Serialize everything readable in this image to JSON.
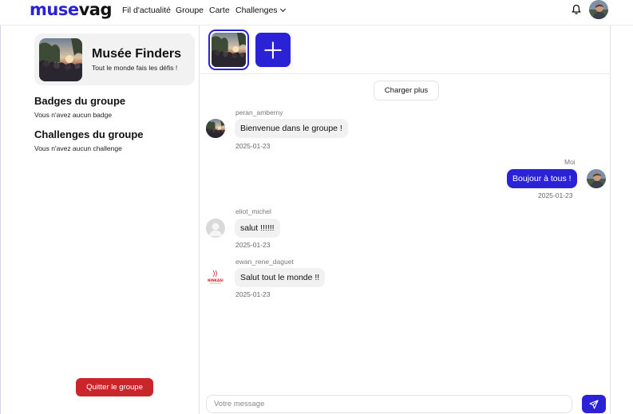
{
  "brand": {
    "part1": "muse",
    "part2": "vag",
    "accent": "#2b22d6"
  },
  "nav": {
    "feed": "Fil d'actualité",
    "group": "Groupe",
    "map": "Carte",
    "challenges": "Challenges"
  },
  "header_icons": [
    "bell-icon",
    "user-avatar"
  ],
  "group": {
    "name": "Musée Finders",
    "tagline": "Tout le monde fais les défis !"
  },
  "badges": {
    "title": "Badges du groupe",
    "empty": "Vous n'avez aucun badge"
  },
  "group_challenges": {
    "title": "Challenges du groupe",
    "empty": "Vous n'avez aucun challenge"
  },
  "quit_label": "Quitter le groupe",
  "load_more_label": "Charger plus",
  "messages": [
    {
      "sender": "peran_amberny",
      "text": "Bienvenue dans le groupe !",
      "date": "2025-01-23",
      "own": false
    },
    {
      "sender": "Moi",
      "text": "Boujour à tous !",
      "date": "2025-01-23",
      "own": true
    },
    {
      "sender": "eliot_michel",
      "text": "salut !!!!!!",
      "date": "2025-01-23",
      "own": false
    },
    {
      "sender": "ewan_rene_daguet",
      "text": "Salut tout le monde !!",
      "date": "2025-01-23",
      "own": false
    }
  ],
  "avatar_logo_text": "NINKASI",
  "composer": {
    "placeholder": "Votre message"
  },
  "colors": {
    "danger": "#c9262c",
    "bubble_in": "#f1f1f1"
  }
}
